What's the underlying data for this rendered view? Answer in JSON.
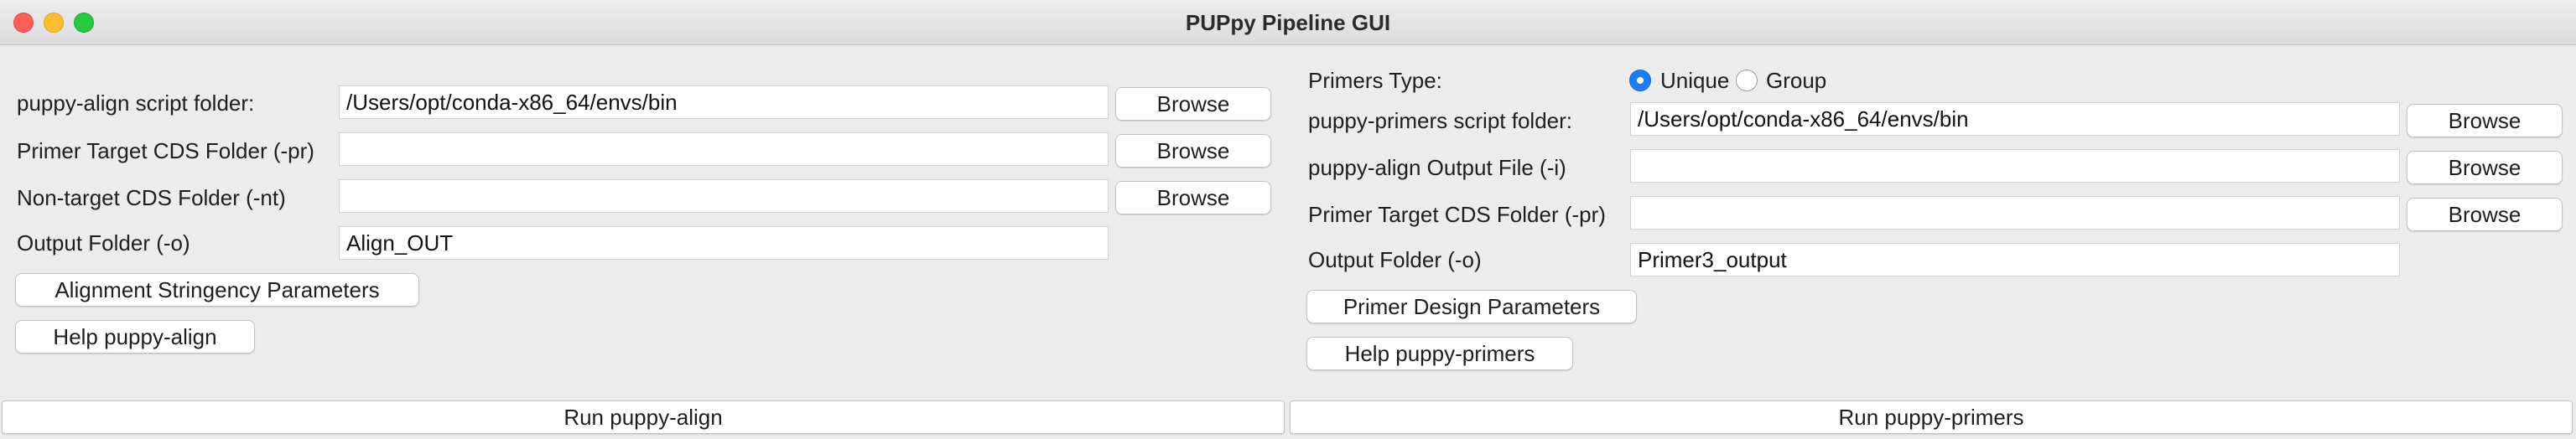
{
  "window": {
    "title": "PUPpy Pipeline GUI"
  },
  "align": {
    "script_folder_label": "puppy-align script folder:",
    "script_folder_value": "/Users/opt/conda-x86_64/envs/bin",
    "target_label": "Primer Target CDS Folder (-pr)",
    "target_value": "",
    "nontarget_label": "Non-target CDS Folder (-nt)",
    "nontarget_value": "",
    "output_label": "Output Folder (-o)",
    "output_value": "Align_OUT",
    "browse_label": "Browse",
    "stringency_button": "Alignment Stringency Parameters",
    "help_button": "Help puppy-align",
    "run_button": "Run puppy-align"
  },
  "primers": {
    "type_label": "Primers Type:",
    "type_options": [
      "Unique",
      "Group"
    ],
    "type_selected": "Unique",
    "script_folder_label": "puppy-primers script folder:",
    "script_folder_value": "/Users/opt/conda-x86_64/envs/bin",
    "align_output_label": "puppy-align Output File (-i)",
    "align_output_value": "",
    "target_label": "Primer Target CDS Folder (-pr)",
    "target_value": "",
    "output_label": "Output Folder (-o)",
    "output_value": "Primer3_output",
    "browse_label": "Browse",
    "design_button": "Primer Design Parameters",
    "help_button": "Help puppy-primers",
    "run_button": "Run puppy-primers"
  }
}
